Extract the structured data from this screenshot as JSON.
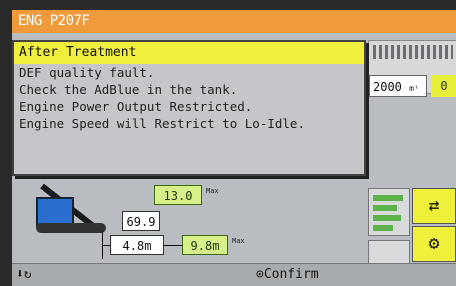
{
  "header": {
    "title": "ENG P207F"
  },
  "status": {
    "hours_value": "2000",
    "hours_unit": "mᵗ",
    "fuel_badge": "0"
  },
  "popup": {
    "title": "After Treatment",
    "lines": [
      "DEF quality fault.",
      "Check the AdBlue in the tank.",
      "Engine Power Output Restricted.",
      "Engine Speed will Restrict to Lo-Idle."
    ]
  },
  "diagram": {
    "height_value": "13.0",
    "height_max": "Max",
    "depth_value": "69.9",
    "reach_value": "4.8m",
    "reach_max_value": "9.8m",
    "reach_max": "Max"
  },
  "footer": {
    "left_icons": "⬇↻",
    "confirm_label": "⊙Confirm"
  },
  "colors": {
    "topbar": "#ef9b3c",
    "popup_head": "#f0ef3c",
    "green_box": "#d8f08a"
  }
}
